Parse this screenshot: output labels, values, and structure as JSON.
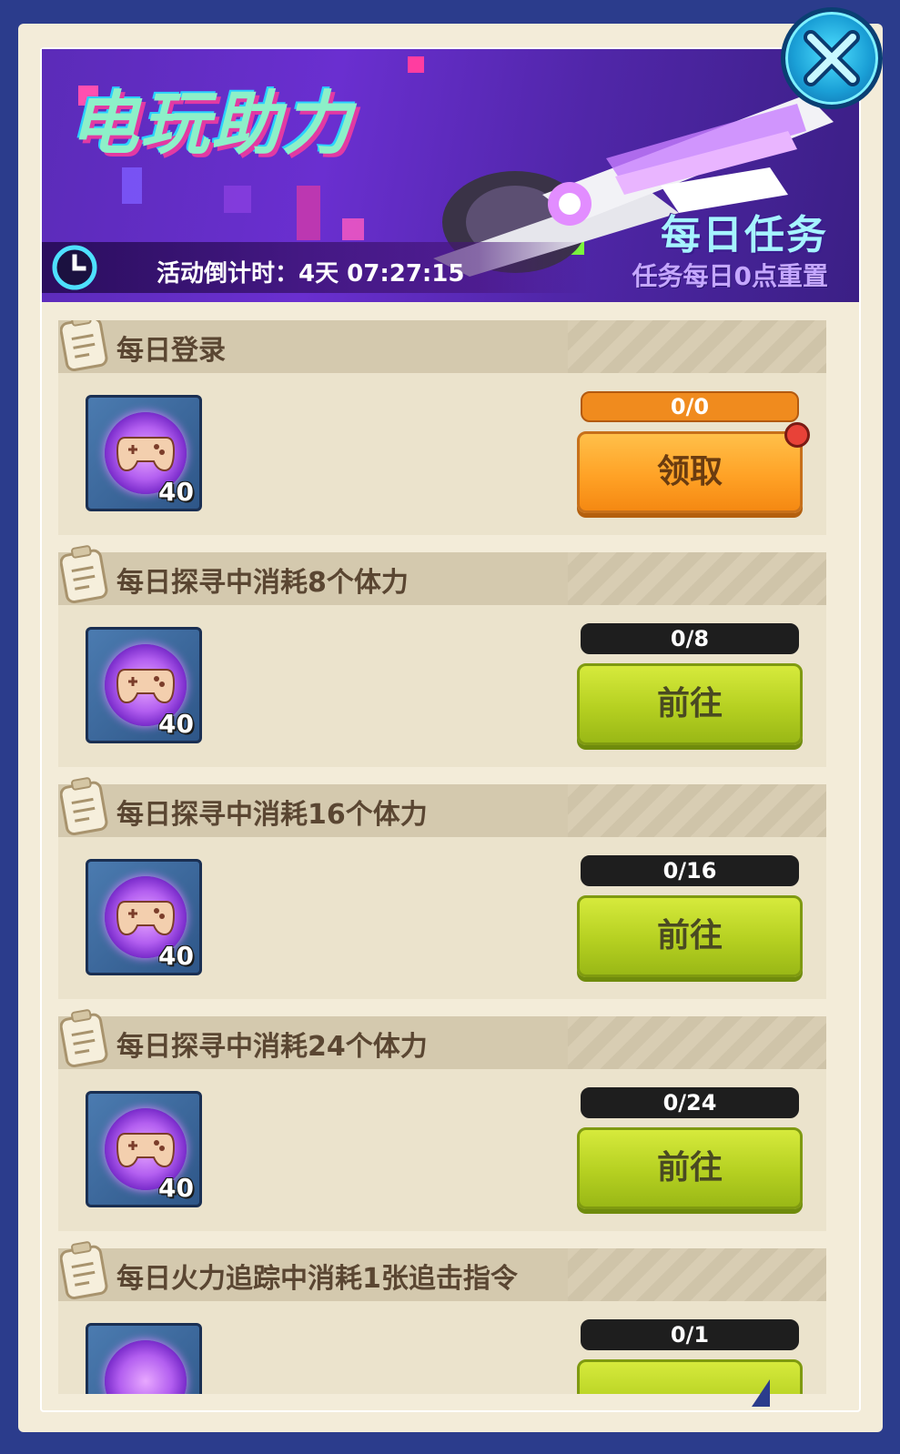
{
  "banner": {
    "title": "电玩助力",
    "daily_title": "每日任务",
    "daily_sub": "任务每日0点重置",
    "countdown": "活动倒计时：4天 07:27:15"
  },
  "tasks": [
    {
      "title": "每日登录",
      "reward_count": "40",
      "progress": "0/0",
      "action": "领取",
      "state": "claimable"
    },
    {
      "title": "每日探寻中消耗8个体力",
      "reward_count": "40",
      "progress": "0/8",
      "action": "前往",
      "state": "go"
    },
    {
      "title": "每日探寻中消耗16个体力",
      "reward_count": "40",
      "progress": "0/16",
      "action": "前往",
      "state": "go"
    },
    {
      "title": "每日探寻中消耗24个体力",
      "reward_count": "40",
      "progress": "0/24",
      "action": "前往",
      "state": "go"
    },
    {
      "title": "每日火力追踪中消耗1张追击指令",
      "reward_count": "",
      "progress": "0/1",
      "action": "",
      "state": "go"
    }
  ],
  "colors": {
    "background": "#2b3c8c",
    "panel": "#f3ecd9",
    "claim_button": "#ffa226",
    "go_button": "#b5d021",
    "badge": "#e84238"
  }
}
